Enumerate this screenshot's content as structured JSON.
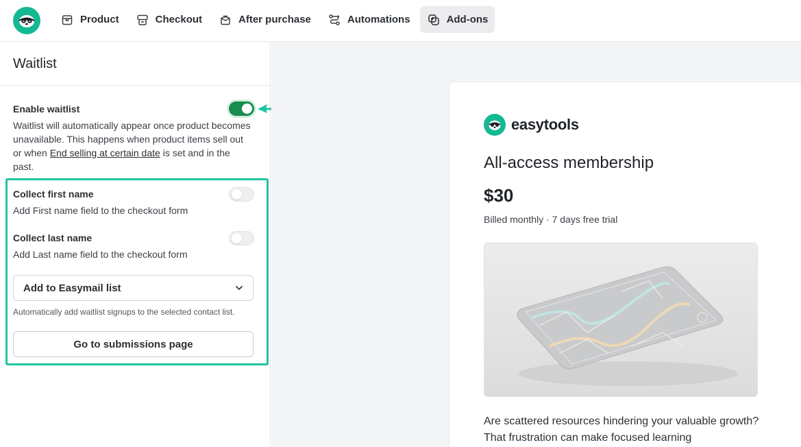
{
  "nav": {
    "tabs": [
      {
        "label": "Product",
        "icon": "box-icon",
        "active": false
      },
      {
        "label": "Checkout",
        "icon": "checkout-icon",
        "active": false
      },
      {
        "label": "After purchase",
        "icon": "package-icon",
        "active": false
      },
      {
        "label": "Automations",
        "icon": "automations-icon",
        "active": false
      },
      {
        "label": "Add-ons",
        "icon": "addons-icon",
        "active": true
      }
    ]
  },
  "panel": {
    "title": "Waitlist",
    "enable": {
      "label": "Enable waitlist",
      "enabled": true,
      "desc_before": "Waitlist will automatically appear once product becomes unavailable. This happens when product items sell out or when ",
      "desc_link": "End selling at certain date",
      "desc_after": " is set and in the past."
    },
    "first_name": {
      "label": "Collect first name",
      "desc": "Add First name field to the checkout form",
      "enabled": false
    },
    "last_name": {
      "label": "Collect last name",
      "desc": "Add Last name field to the checkout form",
      "enabled": false
    },
    "easymail_select": {
      "value": "Add to Easymail list"
    },
    "easymail_help": "Automatically add waitlist signups to the selected contact list.",
    "submissions_button": "Go to submissions page"
  },
  "preview": {
    "brand": "easytools",
    "product_title": "All-access membership",
    "price": "$30",
    "billing": "Billed monthly · 7 days free trial",
    "blurb": "Are scattered resources hindering your valuable growth? That frustration can make focused learning"
  },
  "colors": {
    "accent_green": "#1a8d4e",
    "highlight_teal": "#21c4a0",
    "logo_teal": "#14b892"
  }
}
